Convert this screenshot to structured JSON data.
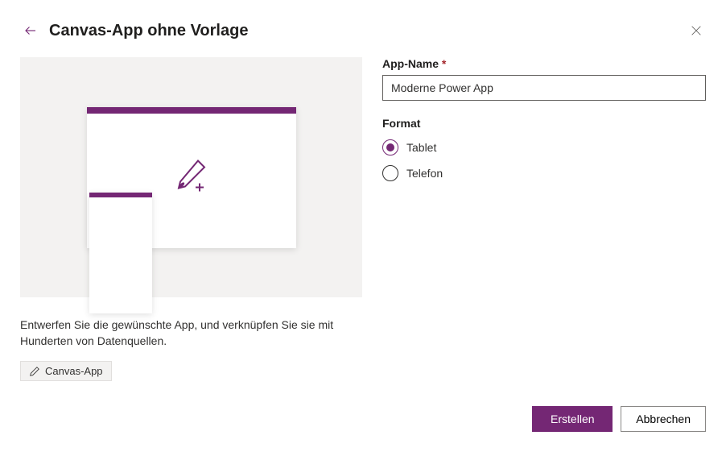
{
  "header": {
    "title": "Canvas-App ohne Vorlage"
  },
  "form": {
    "app_name_label": "App-Name",
    "app_name_value": "Moderne Power App",
    "format_label": "Format",
    "options": {
      "tablet": "Tablet",
      "phone": "Telefon"
    },
    "selected": "tablet"
  },
  "description": "Entwerfen Sie die gewünschte App, und verknüpfen Sie sie mit Hunderten von Datenquellen.",
  "tag": {
    "label": "Canvas-App"
  },
  "footer": {
    "create": "Erstellen",
    "cancel": "Abbrechen"
  },
  "colors": {
    "accent": "#742774"
  }
}
